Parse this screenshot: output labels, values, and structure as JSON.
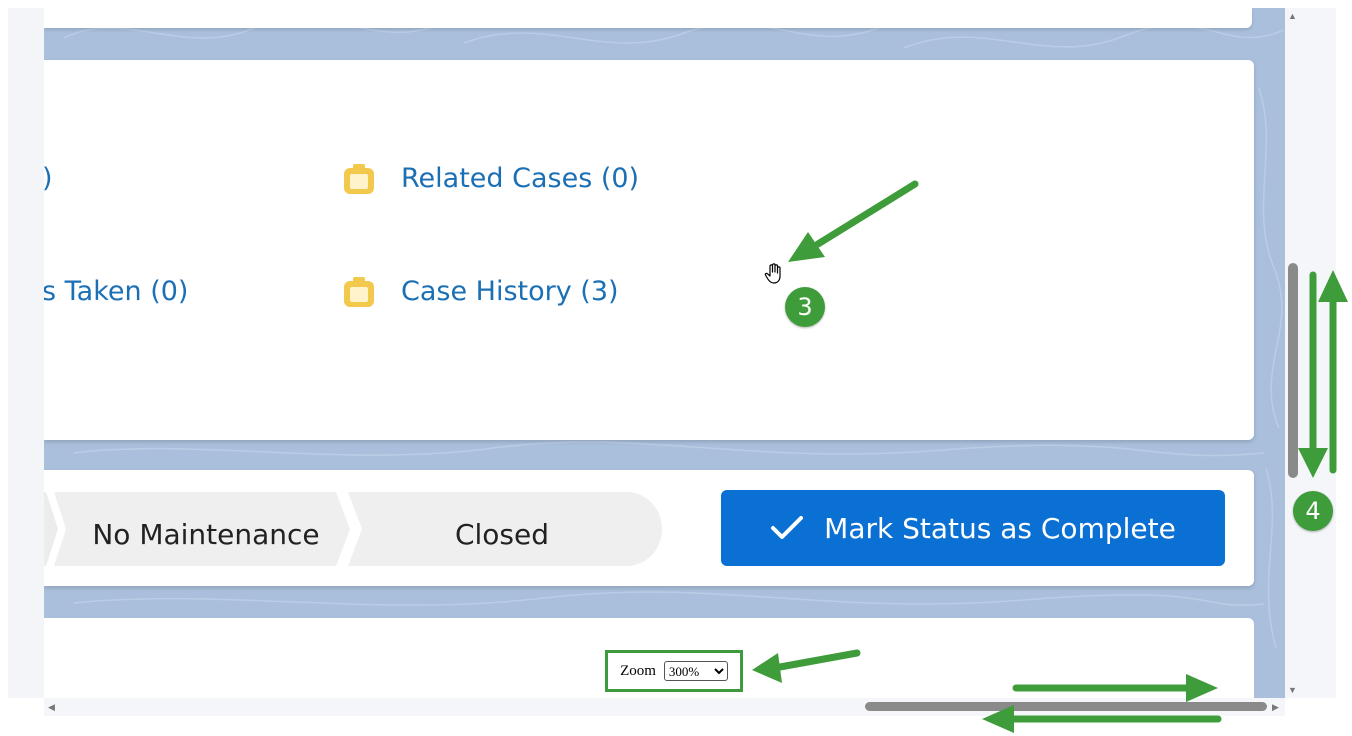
{
  "related_list": {
    "partial_top": ")",
    "partial_bottom": "s Taken (0)",
    "items": [
      {
        "label": "Related Cases (0)",
        "icon": "folder-icon"
      },
      {
        "label": "Case History (3)",
        "icon": "folder-icon"
      }
    ]
  },
  "status_path": {
    "steps": [
      "No Maintenance",
      "Closed"
    ],
    "action_label": "Mark Status as Complete",
    "action_icon": "checkmark-icon"
  },
  "zoom": {
    "label": "Zoom",
    "value": "300%"
  },
  "annotations": {
    "badge_3": "3",
    "badge_4": "4",
    "color": "#3e9d3a"
  },
  "colors": {
    "link": "#1b6fb5",
    "button": "#0b70d3",
    "icon": "#f2c94c",
    "background": "#a9bfdc"
  }
}
